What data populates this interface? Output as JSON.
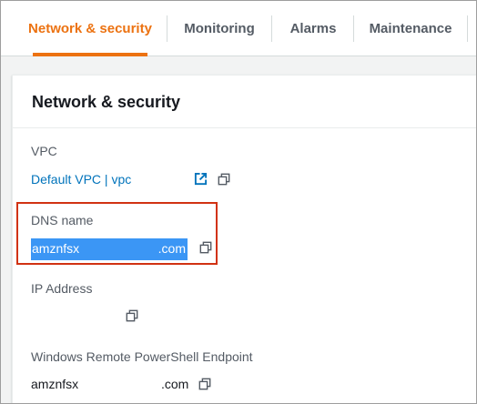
{
  "tabs": [
    {
      "label": "Network & security",
      "active": true
    },
    {
      "label": "Monitoring",
      "active": false
    },
    {
      "label": "Alarms",
      "active": false
    },
    {
      "label": "Maintenance",
      "active": false
    }
  ],
  "panel": {
    "title": "Network & security",
    "vpc": {
      "label": "VPC",
      "value": "Default VPC | vpc"
    },
    "dns": {
      "label": "DNS name",
      "value_prefix": "amznfsx",
      "value_suffix": ".com"
    },
    "ip": {
      "label": "IP Address"
    },
    "powershell": {
      "label": "Windows Remote PowerShell Endpoint",
      "value_prefix": "amznfsx",
      "value_suffix": ".com"
    }
  },
  "colors": {
    "accent": "#ec7211",
    "link": "#0073bb",
    "highlight": "#d13212",
    "selection": "#3b96f5"
  },
  "icons": [
    "external-link-icon",
    "copy-icon"
  ]
}
